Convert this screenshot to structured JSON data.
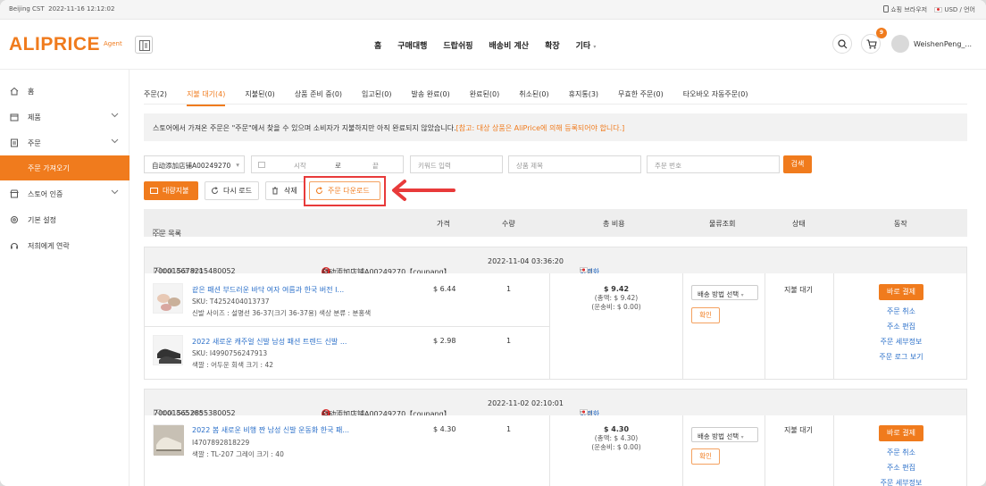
{
  "topbar": {
    "timezone": "Beijing CST",
    "datetime": "2022-11-16 12:12:02",
    "shop_browser": "쇼핑 브라우저",
    "currency_lang": "USD / 언어"
  },
  "header": {
    "logo": "ALIPRICE",
    "logo_tag": "Agent",
    "nav": [
      "홈",
      "구매대행",
      "드랍쉬핑",
      "배송비 계산",
      "확장",
      "기타"
    ],
    "cart_count": "9",
    "username": "WeishenPeng_..."
  },
  "sidebar": {
    "items": [
      {
        "label": "홈",
        "icon": "home-icon"
      },
      {
        "label": "제품",
        "icon": "box-icon"
      },
      {
        "label": "주문",
        "icon": "order-icon"
      },
      {
        "label": "주문 가져오기",
        "icon": ""
      },
      {
        "label": "스토어 인증",
        "icon": "store-icon"
      },
      {
        "label": "기본 설정",
        "icon": "gear-icon"
      },
      {
        "label": "저희에게 연락",
        "icon": "contact-icon"
      }
    ]
  },
  "tabs": [
    "주문(2)",
    "지불 대기(4)",
    "지불된(0)",
    "상품 준비 중(0)",
    "입고된(0)",
    "발송 완료(0)",
    "완료된(0)",
    "취소된(0)",
    "휴지통(3)",
    "무효한 주문(0)",
    "타오바오 자동주문(0)"
  ],
  "notice": {
    "text": "스토어에서 가져온 주문은 \"주문\"에서 찾을 수 있으며 소비자가 지불하지만 아직 완료되지 않았습니다.",
    "warning": "[참고: 대상 상품은 AliPrice에 의해 등록되어야 합니다.]"
  },
  "filters": {
    "store": "自动添加店铺A00249270",
    "date_start": "시작",
    "date_sep": "로",
    "date_end": "끝",
    "keyword": "키워드 입력",
    "product_title": "상품 제목",
    "order_no": "주문 번호",
    "search_btn": "검색"
  },
  "actions": {
    "bulk_pay": "대량지불",
    "reload": "다시 로드",
    "delete": "삭제",
    "download": "주문 다운로드"
  },
  "table_headers": {
    "items": "주문 목록",
    "price": "가격",
    "qty": "수량",
    "total": "총 비용",
    "logistics": "물류조회",
    "status": "상태",
    "action": "동작"
  },
  "orders": [
    {
      "order_label": "스토어 주문 번호:",
      "order_no": "700015678215480052",
      "store": "自动添加店铺A00249270【coupang】",
      "datetime": "2022-11-04 03:36:20",
      "customer_label": "고객:",
      "customer": "이련화",
      "items": [
        {
          "name": "같은 패션 부드러운 바닥 여자 여름과 한국 버전 I...",
          "sku": "SKU:  T4252404013737",
          "attr": "신발 사이즈 : 설명선 36-37(크기 36-37용)  색상 분류 : 분홍색",
          "price": "$ 6.44",
          "qty": "1"
        },
        {
          "name": "2022 새로운 캐주얼 신발 남성 패션 트렌드 신발 ...",
          "sku": "SKU:  I4990756247913",
          "attr": "색깔 : 어두운 회색  크기 :  42",
          "price": "$ 2.98",
          "qty": "1"
        }
      ],
      "total": "$ 9.42",
      "total_sub": "(총액: $ 9.42)",
      "shipping_fee": "(운송비: $ 0.00)",
      "ship_select": "배송 방법 선택",
      "confirm": "확인",
      "status": "지불 대기",
      "pay": "바로 결제",
      "links": [
        "주문 취소",
        "주소 편집",
        "주문 세부정보",
        "주문 로그 보기"
      ]
    },
    {
      "order_label": "스토어 주문 번호:",
      "order_no": "700015652855380052",
      "store": "自动添加店铺A00249270【coupang】",
      "datetime": "2022-11-02 02:10:01",
      "customer_label": "고객:",
      "customer": "이련화",
      "items": [
        {
          "name": "2022 봄 새로운 비행 짠 남성 신발 운동화 한국 패...",
          "sku": "I4707892818229",
          "attr": "색깔 : TL-207 그레이  크기 :  40",
          "price": "$ 4.30",
          "qty": "1"
        }
      ],
      "total": "$ 4.30",
      "total_sub": "(총액: $ 4.30)",
      "shipping_fee": "(운송비: $ 0.00)",
      "ship_select": "배송 방법 선택",
      "confirm": "확인",
      "status": "지불 대기",
      "pay": "바로 결제",
      "links": [
        "주문 취소",
        "주소 편집",
        "주문 세부정보"
      ]
    }
  ],
  "colors": {
    "accent": "#f07b1d",
    "link": "#2a6fc9",
    "highlight": "#e83a3a"
  }
}
